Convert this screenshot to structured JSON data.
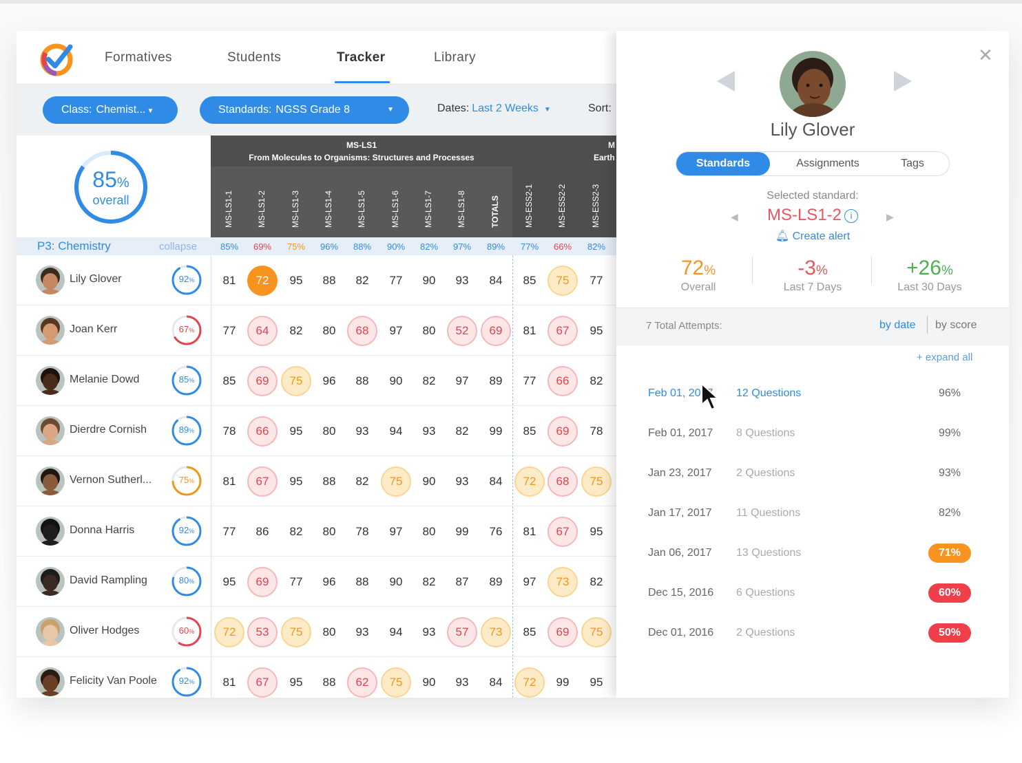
{
  "nav": {
    "items": [
      "Formatives",
      "Students",
      "Tracker",
      "Library"
    ],
    "active": "Tracker"
  },
  "filters": {
    "class_label": "Class:",
    "class_value": "Chemist...",
    "standards_label": "Standards:",
    "standards_value": "NGSS Grade 8",
    "dates_label": "Dates:",
    "dates_value": "Last 2 Weeks",
    "sort_label": "Sort:"
  },
  "overall": {
    "value": "85",
    "unit": "%",
    "label": "overall",
    "fraction": 0.85
  },
  "groups": [
    {
      "code": "MS-LS1",
      "title": "From Molecules to Organisms: Structures and Processes"
    },
    {
      "code": "M",
      "title": "Earth"
    }
  ],
  "columns": [
    "MS-LS1-1",
    "MS-LS1-2",
    "MS-LS1-3",
    "MS-LS1-4",
    "MS-LS1-5",
    "MS-LS1-6",
    "MS-LS1-7",
    "MS-LS1-8",
    "TOTALS",
    "MS-ESS2-1",
    "MS-ESS2-2",
    "MS-ESS2-3"
  ],
  "class_row": {
    "name": "P3:  Chemistry",
    "collapse": "collapse",
    "percents": [
      "85%",
      "69%",
      "75%",
      "96%",
      "88%",
      "90%",
      "82%",
      "97%",
      "89%",
      "77%",
      "66%",
      "82%"
    ]
  },
  "students": [
    {
      "name": "Lily Glover",
      "overall": "92",
      "scores": [
        81,
        72,
        95,
        88,
        82,
        77,
        90,
        93,
        84,
        85,
        75,
        77
      ]
    },
    {
      "name": "Joan Kerr",
      "overall": "67",
      "scores": [
        77,
        64,
        82,
        80,
        68,
        97,
        80,
        52,
        69,
        81,
        67,
        95
      ]
    },
    {
      "name": "Melanie Dowd",
      "overall": "85",
      "scores": [
        85,
        69,
        75,
        96,
        88,
        90,
        82,
        97,
        89,
        77,
        66,
        82
      ]
    },
    {
      "name": "Dierdre Cornish",
      "overall": "89",
      "scores": [
        78,
        66,
        95,
        80,
        93,
        94,
        93,
        82,
        99,
        85,
        69,
        78
      ]
    },
    {
      "name": "Vernon Sutherl...",
      "overall": "75",
      "scores": [
        81,
        67,
        95,
        88,
        82,
        75,
        90,
        93,
        84,
        72,
        68,
        75
      ]
    },
    {
      "name": "Donna Harris",
      "overall": "92",
      "scores": [
        77,
        86,
        82,
        80,
        78,
        97,
        80,
        99,
        76,
        81,
        67,
        95
      ]
    },
    {
      "name": "David Rampling",
      "overall": "80",
      "scores": [
        95,
        69,
        77,
        96,
        88,
        90,
        82,
        87,
        89,
        97,
        73,
        82
      ]
    },
    {
      "name": "Oliver Hodges",
      "overall": "60",
      "scores": [
        72,
        53,
        75,
        80,
        93,
        94,
        93,
        57,
        73,
        85,
        69,
        75
      ]
    },
    {
      "name": "Felicity Van Poole",
      "overall": "92",
      "scores": [
        81,
        67,
        95,
        88,
        62,
        75,
        90,
        93,
        84,
        72,
        99,
        95
      ]
    }
  ],
  "panel": {
    "student_name": "Lily Glover",
    "tabs": [
      "Standards",
      "Assignments",
      "Tags"
    ],
    "active_tab": "Standards",
    "selected_label": "Selected standard:",
    "selected_standard": "MS-LS1-2",
    "info_icon": "i",
    "create_alert": "Create alert",
    "stats": [
      {
        "value": "72",
        "unit": "%",
        "label": "Overall",
        "color": "#f7931e"
      },
      {
        "value": "-3",
        "unit": "%",
        "label": "Last 7 Days",
        "color": "#e4585f"
      },
      {
        "value": "+26",
        "unit": "%",
        "label": "Last 30 Days",
        "color": "#4caf50"
      }
    ],
    "attempts_label": "7 Total Attempts:",
    "by_date": "by date",
    "by_score": "by score",
    "expand_all": "+ expand all",
    "attempts": [
      {
        "date": "Feb 01, 2017",
        "questions": "12 Questions",
        "score": "96%",
        "style": "plain"
      },
      {
        "date": "Feb 01, 2017",
        "questions": "8 Questions",
        "score": "99%",
        "style": "plain"
      },
      {
        "date": "Jan 23, 2017",
        "questions": "2 Questions",
        "score": "93%",
        "style": "plain"
      },
      {
        "date": "Jan 17, 2017",
        "questions": "11 Questions",
        "score": "82%",
        "style": "plain"
      },
      {
        "date": "Jan 06, 2017",
        "questions": "13 Questions",
        "score": "71%",
        "style": "org"
      },
      {
        "date": "Dec 15, 2016",
        "questions": "6 Questions",
        "score": "60%",
        "style": "red"
      },
      {
        "date": "Dec 01, 2016",
        "questions": "2 Questions",
        "score": "50%",
        "style": "red"
      }
    ]
  },
  "colors": {
    "accent": "#2f8be6",
    "red": "#e4424d",
    "yellow": "#f0971a",
    "orange": "#f7931e",
    "green": "#4caf50"
  }
}
